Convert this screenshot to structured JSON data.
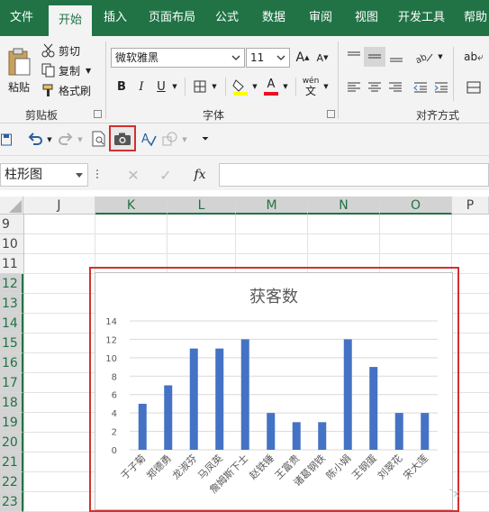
{
  "ribbon_tabs": [
    "文件",
    "开始",
    "插入",
    "页面布局",
    "公式",
    "数据",
    "审阅",
    "视图",
    "开发工具",
    "帮助"
  ],
  "active_tab": "开始",
  "clipboard": {
    "paste": "粘贴",
    "cut": "剪切",
    "copy": "复制",
    "format_painter": "格式刷",
    "group_label": "剪贴板"
  },
  "font": {
    "family": "微软雅黑",
    "size": "11",
    "bold": "B",
    "italic": "I",
    "underline": "U",
    "phonetic": "wén",
    "group_label": "字体"
  },
  "alignment": {
    "group_label": "对齐方式"
  },
  "name_box": "柱形图",
  "columns": [
    "J",
    "K",
    "L",
    "M",
    "N",
    "O",
    "P"
  ],
  "selected_columns": [
    "K",
    "L",
    "M",
    "N",
    "O"
  ],
  "rows": [
    "9",
    "10",
    "11",
    "12",
    "13",
    "14",
    "15",
    "16",
    "17",
    "18",
    "19",
    "20",
    "21",
    "22",
    "23"
  ],
  "selected_rows": [
    "12",
    "13",
    "14",
    "15",
    "16",
    "17",
    "18",
    "19",
    "20",
    "21",
    "22",
    "23"
  ],
  "colors": {
    "ribbon_green": "#217346",
    "bar": "#4472c4",
    "highlight": "#d32f2f",
    "font_color_red": "#e81123",
    "fill_yellow": "#ffff00"
  },
  "chart_data": {
    "type": "bar",
    "title": "获客数",
    "categories": [
      "于子菊",
      "郑德勇",
      "龙淑芬",
      "马凤英",
      "詹姆斯下士",
      "赵铁锤",
      "王富贵",
      "诸葛钢铁",
      "陈小娟",
      "王钢蛋",
      "刘翠花",
      "宋大莲"
    ],
    "values": [
      5,
      7,
      11,
      11,
      12,
      4,
      3,
      3,
      12,
      9,
      4,
      4
    ],
    "ylim": [
      0,
      14
    ],
    "yticks": [
      "0",
      "2",
      "4",
      "6",
      "8",
      "10",
      "12",
      "14"
    ],
    "grid": true
  }
}
